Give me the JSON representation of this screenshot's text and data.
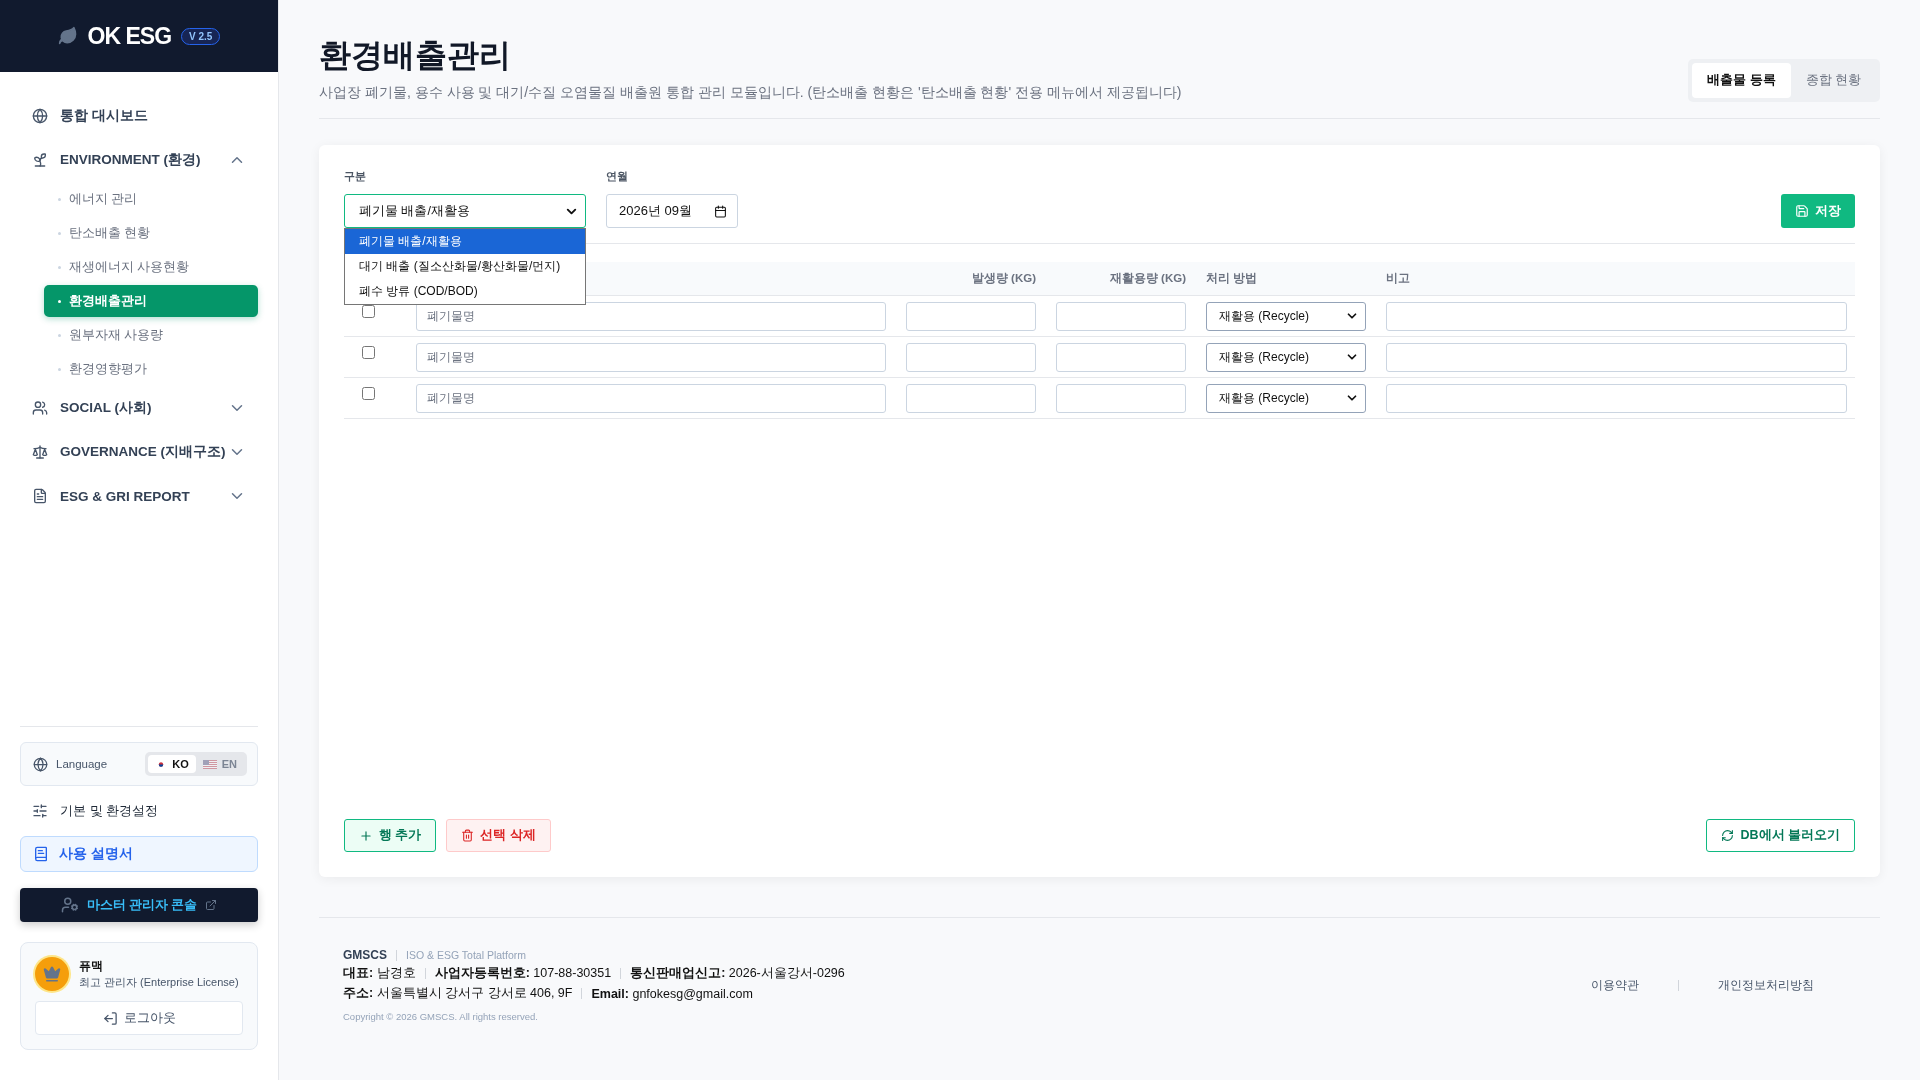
{
  "brand": {
    "name": "OK ESG",
    "version": "V 2.5"
  },
  "nav": [
    {
      "label": "통합 대시보드"
    },
    {
      "label": "ENVIRONMENT (환경)",
      "expanded": true,
      "children": [
        {
          "label": "에너지 관리",
          "selected": false
        },
        {
          "label": "탄소배출 현황",
          "selected": false
        },
        {
          "label": "재생에너지 사용현황",
          "selected": false
        },
        {
          "label": "환경배출관리",
          "selected": true
        },
        {
          "label": "원부자재 사용량",
          "selected": false
        },
        {
          "label": "환경영향평가",
          "selected": false
        }
      ]
    },
    {
      "label": "SOCIAL (사회)",
      "expanded": false
    },
    {
      "label": "GOVERNANCE (지배구조)",
      "expanded": false
    },
    {
      "label": "ESG & GRI REPORT",
      "expanded": false
    }
  ],
  "language": {
    "label": "Language",
    "options": [
      {
        "label": "KO",
        "selected": true
      },
      {
        "label": "EN",
        "selected": false
      }
    ]
  },
  "settings_link": "기본 및 환경설정",
  "manual_link": "사용 설명서",
  "admin_console_button": "마스터 관리자 콘솔",
  "user": {
    "name": "퓨맥",
    "role": "최고 관리자 (Enterprise License)"
  },
  "logout_button": "로그아웃",
  "page": {
    "title": "환경배출관리",
    "description": "사업장 폐기물, 용수 사용 및 대기/수질 오염물질 배출원 통합 관리 모듈입니다. (탄소배출 현황은 '탄소배출 현황' 전용 메뉴에서 제공됩니다)",
    "tabs": [
      {
        "label": "배출물 등록",
        "selected": true
      },
      {
        "label": "종합 현황",
        "selected": false
      }
    ]
  },
  "form": {
    "category": {
      "label": "구분",
      "value": "폐기물 배출/재활용",
      "expanded": true,
      "options": [
        {
          "label": "폐기물 배출/재활용",
          "selected": true
        },
        {
          "label": "대기 배출 (질소산화물/황산화물/먼지)",
          "selected": false
        },
        {
          "label": "폐수 방류 (COD/BOD)",
          "selected": false
        }
      ]
    },
    "period": {
      "label": "연월",
      "value": "2026년 09월"
    },
    "save_button": "저장"
  },
  "table": {
    "columns": [
      "발생량 (KG)",
      "재활용량 (KG)",
      "처리 방법",
      "비고"
    ],
    "rows": [
      {
        "checked": false,
        "name_placeholder": "폐기물명",
        "method": "재활용 (Recycle)"
      },
      {
        "checked": false,
        "name_placeholder": "폐기물명",
        "method": "재활용 (Recycle)"
      },
      {
        "checked": false,
        "name_placeholder": "폐기물명",
        "method": "재활용 (Recycle)"
      }
    ]
  },
  "actions": {
    "add_row": "행 추가",
    "delete_selected": "선택 삭제",
    "load_db": "DB에서 불러오기"
  },
  "footer": {
    "company": "GMSCS",
    "tagline": "ISO & ESG Total Platform",
    "lines": [
      [
        "**대표:** 남경호",
        "**사업자등록번호:** 107-88-30351",
        "**통신판매업신고:** 2026-서울강서-0296"
      ],
      [
        "**주소:** 서울특별시 강서구 강서로 406, 9F",
        "**Email:** gnfokesg@gmail.com"
      ]
    ],
    "copyright": "Copyright © 2026 GMSCS. All rights reserved.",
    "links": [
      "이용약관",
      "개인정보처리방침"
    ]
  }
}
